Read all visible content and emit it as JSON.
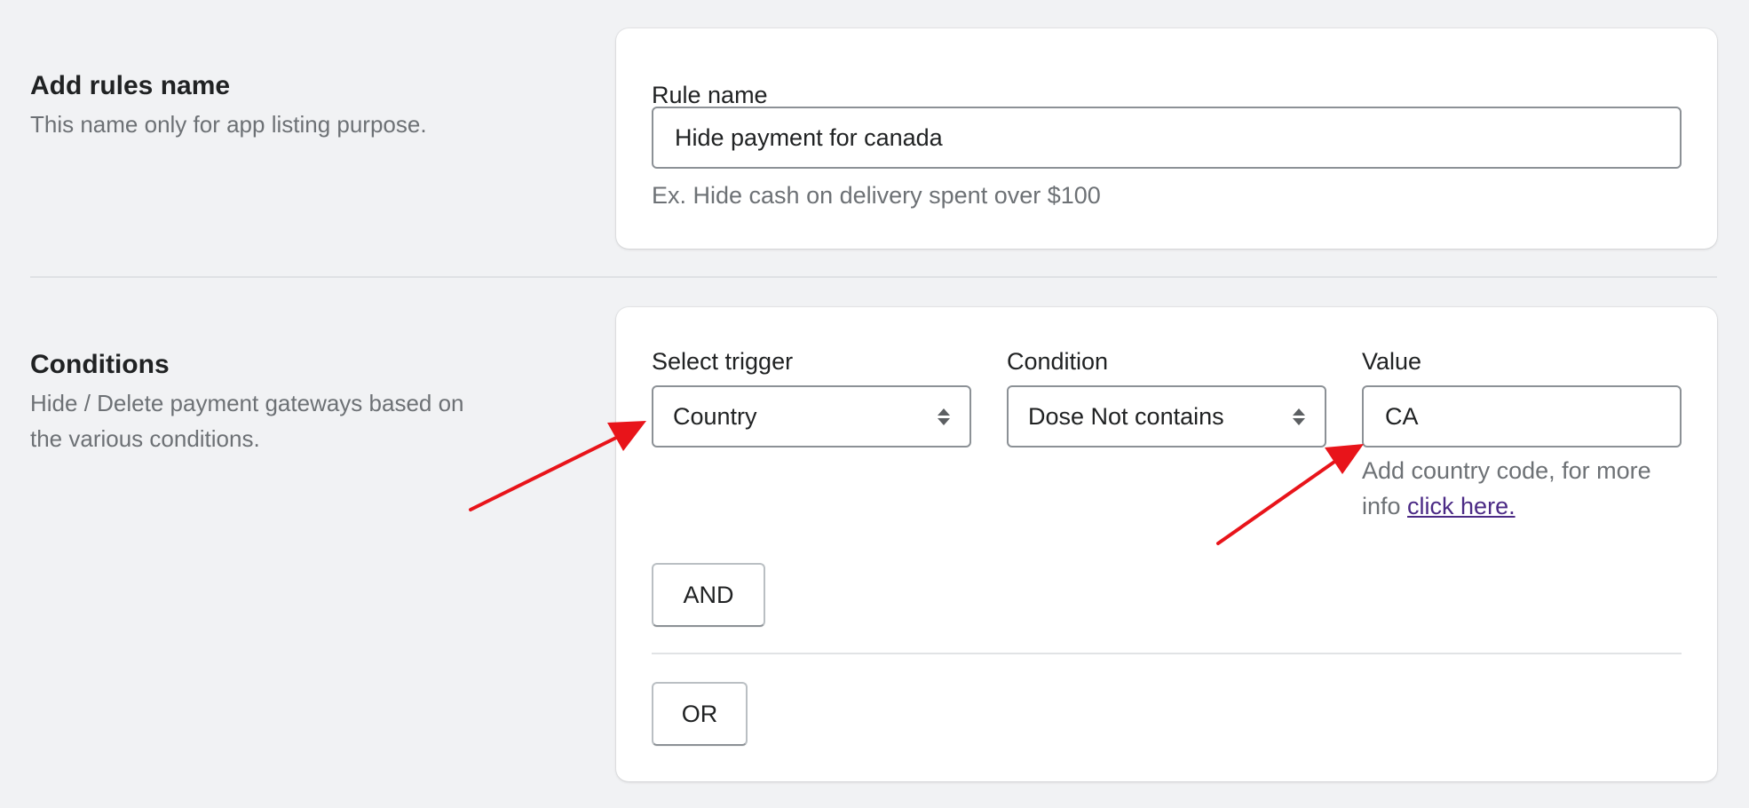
{
  "rule_name_section": {
    "title": "Add rules name",
    "description": "This name only for app listing purpose.",
    "field_label": "Rule name",
    "field_value": "Hide payment for canada",
    "help_text": "Ex. Hide cash on delivery spent over $100"
  },
  "conditions_section": {
    "title": "Conditions",
    "description_line1": "Hide / Delete payment gateways based on",
    "description_line2": "the various conditions.",
    "trigger": {
      "label": "Select trigger",
      "selected": "Country"
    },
    "condition": {
      "label": "Condition",
      "selected": "Dose Not contains"
    },
    "value": {
      "label": "Value",
      "current": "CA",
      "help_line1": "Add country code, for more",
      "help_prefix": "info ",
      "help_link": "click here."
    },
    "and_button": "AND",
    "or_button": "OR"
  },
  "annotations": {
    "arrow_color": "#e8141a"
  },
  "icons": {
    "select_arrows": "chevron-up-down-icon"
  }
}
